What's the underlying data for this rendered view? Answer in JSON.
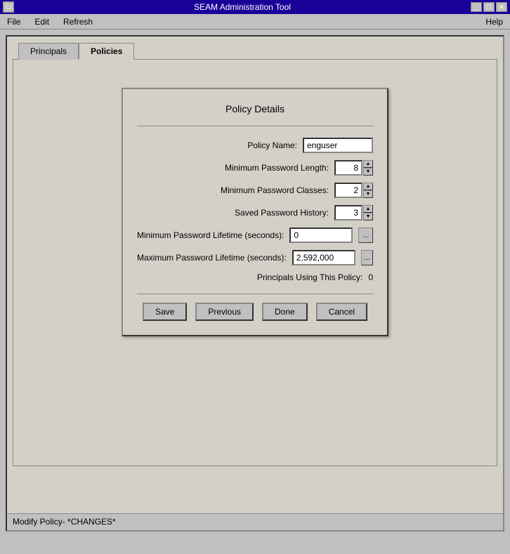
{
  "window": {
    "title": "SEAM Administration Tool",
    "icon": "☐"
  },
  "titlebar": {
    "minimize_label": "_",
    "maximize_label": "□",
    "close_label": "✕"
  },
  "menubar": {
    "items": [
      {
        "label": "File"
      },
      {
        "label": "Edit"
      },
      {
        "label": "Refresh"
      }
    ],
    "help_label": "Help"
  },
  "tabs": [
    {
      "label": "Principals",
      "active": false
    },
    {
      "label": "Policies",
      "active": true
    }
  ],
  "dialog": {
    "title": "Policy Details",
    "fields": {
      "policy_name_label": "Policy Name:",
      "policy_name_value": "enguser",
      "min_pw_length_label": "Minimum Password Length:",
      "min_pw_length_value": "8",
      "min_pw_classes_label": "Minimum Password Classes:",
      "min_pw_classes_value": "2",
      "saved_pw_history_label": "Saved Password History:",
      "saved_pw_history_value": "3",
      "min_pw_lifetime_label": "Minimum Password Lifetime (seconds):",
      "min_pw_lifetime_value": "0",
      "max_pw_lifetime_label": "Maximum Password Lifetime (seconds):",
      "max_pw_lifetime_value": "2,592,000",
      "principals_policy_label": "Principals Using This Policy:",
      "principals_policy_value": "0"
    },
    "buttons": {
      "save": "Save",
      "previous": "Previous",
      "done": "Done",
      "cancel": "Cancel"
    },
    "ellipsis": "..."
  },
  "statusbar": {
    "text": "Modify Policy- *CHANGES*"
  }
}
